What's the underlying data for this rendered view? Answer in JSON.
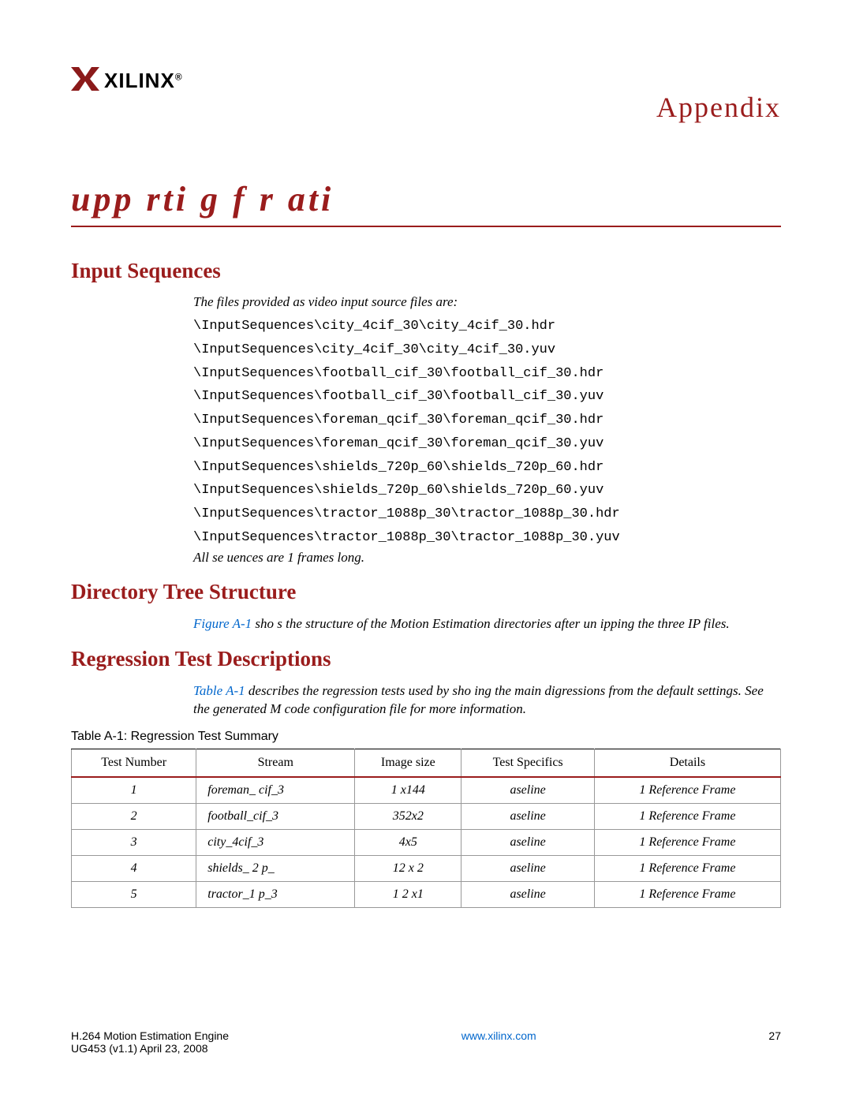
{
  "header": {
    "logo_text": "XILINX",
    "logo_reg": "®",
    "appendix_label": "Appendix"
  },
  "chapter_title": "upp rti g  f r  ati",
  "sections": {
    "input_sequences": {
      "heading": "Input Sequences",
      "intro": "The files provided as video input source files are:",
      "files": [
        "\\InputSequences\\city_4cif_30\\city_4cif_30.hdr",
        "\\InputSequences\\city_4cif_30\\city_4cif_30.yuv",
        "\\InputSequences\\football_cif_30\\football_cif_30.hdr",
        "\\InputSequences\\football_cif_30\\football_cif_30.yuv",
        "\\InputSequences\\foreman_qcif_30\\foreman_qcif_30.hdr",
        "\\InputSequences\\foreman_qcif_30\\foreman_qcif_30.yuv",
        "\\InputSequences\\shields_720p_60\\shields_720p_60.hdr",
        "\\InputSequences\\shields_720p_60\\shields_720p_60.yuv",
        "\\InputSequences\\tractor_1088p_30\\tractor_1088p_30.hdr",
        "\\InputSequences\\tractor_1088p_30\\tractor_1088p_30.yuv"
      ],
      "outro": "All se uences are 1  frames long."
    },
    "directory_tree": {
      "heading": "Directory Tree Structure",
      "fig_ref": "Figure A-1",
      "para_rest": " sho s the structure of the Motion Estimation directories after un ipping the three  IP files."
    },
    "regression": {
      "heading": "Regression Test Descriptions",
      "table_ref": "Table A-1",
      "para_rest": " describes the regression tests used by sho ing the main digressions from the default settings.  See the generated  M code configuration file for more information.",
      "table_caption": "Table A-1:   Regression Test Summary",
      "headers": [
        "Test Number",
        "Stream",
        "Image size",
        "Test Specifics",
        "Details"
      ],
      "rows": [
        [
          "1",
          "foreman_ cif_3",
          "1  x144",
          "aseline",
          "1 Reference Frame"
        ],
        [
          "2",
          "football_cif_3",
          "352x2",
          "aseline",
          "1 Reference Frame"
        ],
        [
          "3",
          "city_4cif_3",
          "4x5",
          "aseline",
          "1 Reference Frame"
        ],
        [
          "4",
          "shields_ 2 p_",
          "12  x 2",
          "aseline",
          "1 Reference Frame"
        ],
        [
          "5",
          "tractor_1   p_3",
          "1 2 x1",
          "aseline",
          "1 Reference Frame"
        ]
      ]
    }
  },
  "footer": {
    "left_line1": "H.264 Motion Estimation Engine",
    "left_line2": "UG453 (v1.1) April 23, 2008",
    "center": "www.xilinx.com",
    "right": "27"
  }
}
